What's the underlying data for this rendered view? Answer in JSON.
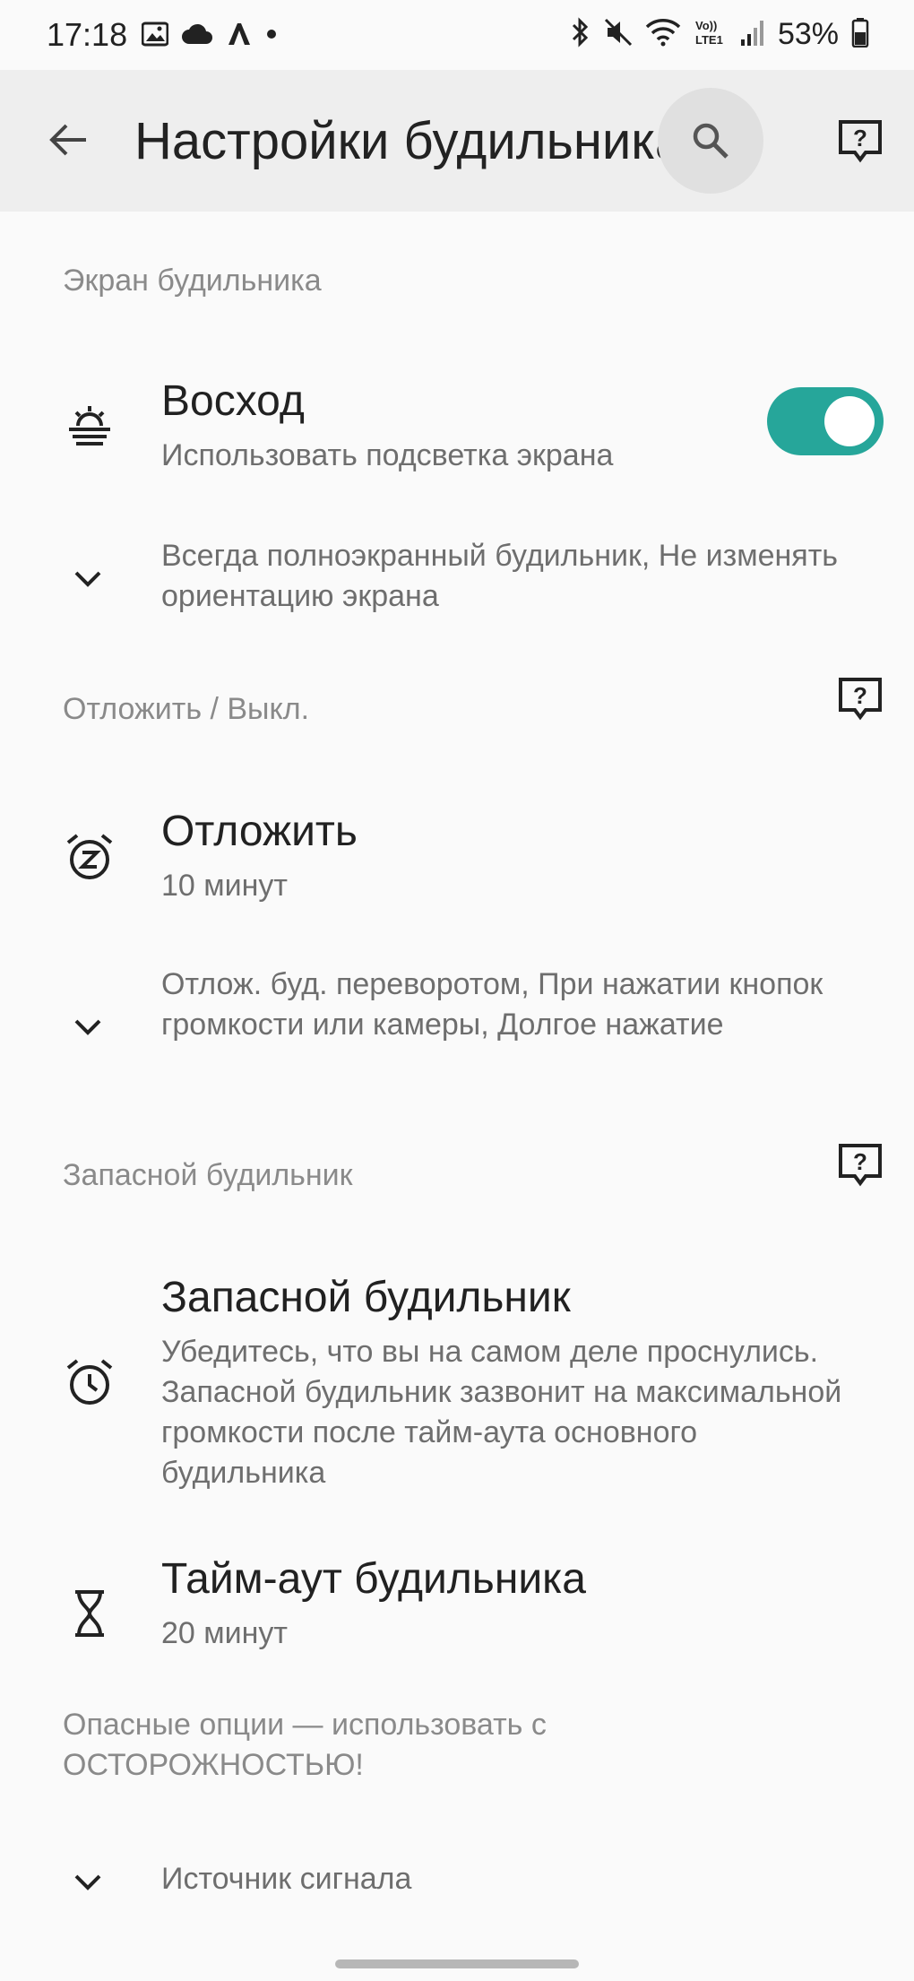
{
  "status_bar": {
    "time": "17:18",
    "battery": "53%",
    "left_icons": [
      "image-icon",
      "cloud-icon",
      "app-a-icon",
      "dot-icon"
    ],
    "right_icons": [
      "bluetooth-icon",
      "mute-icon",
      "wifi-icon",
      "volte-icon",
      "signal-icon",
      "battery-icon"
    ]
  },
  "app_bar": {
    "title": "Настройки будильника"
  },
  "sections": {
    "alarm_screen": {
      "header": "Экран будильника",
      "sunrise": {
        "title": "Восход",
        "subtitle": "Использовать подсветка экрана",
        "toggle_on": true
      },
      "more": "Всегда полноэкранный будильник, Не изменять ориентацию экрана"
    },
    "snooze": {
      "header": "Отложить / Выкл.",
      "snooze_item": {
        "title": "Отложить",
        "subtitle": "10 минут"
      },
      "more": "Отлож. буд. переворотом, При нажатии кнопок громкости или камеры, Долгое нажатие"
    },
    "backup": {
      "header": "Запасной будильник",
      "backup_item": {
        "title": "Запасной будильник",
        "subtitle": "Убедитесь, что вы на самом деле проснулись. Запасной будильник зазвонит на максимальной громкости после тайм-аута основного будильника"
      },
      "timeout_item": {
        "title": "Тайм-аут будильника",
        "subtitle": "20 минут"
      }
    },
    "dangerous": {
      "header": "Опасные опции — использовать с ОСТОРОЖНОСТЬЮ!",
      "source": "Источник сигнала"
    }
  },
  "colors": {
    "accent": "#26a69a",
    "background": "#fafafa",
    "app_bar": "#eeeeee"
  }
}
